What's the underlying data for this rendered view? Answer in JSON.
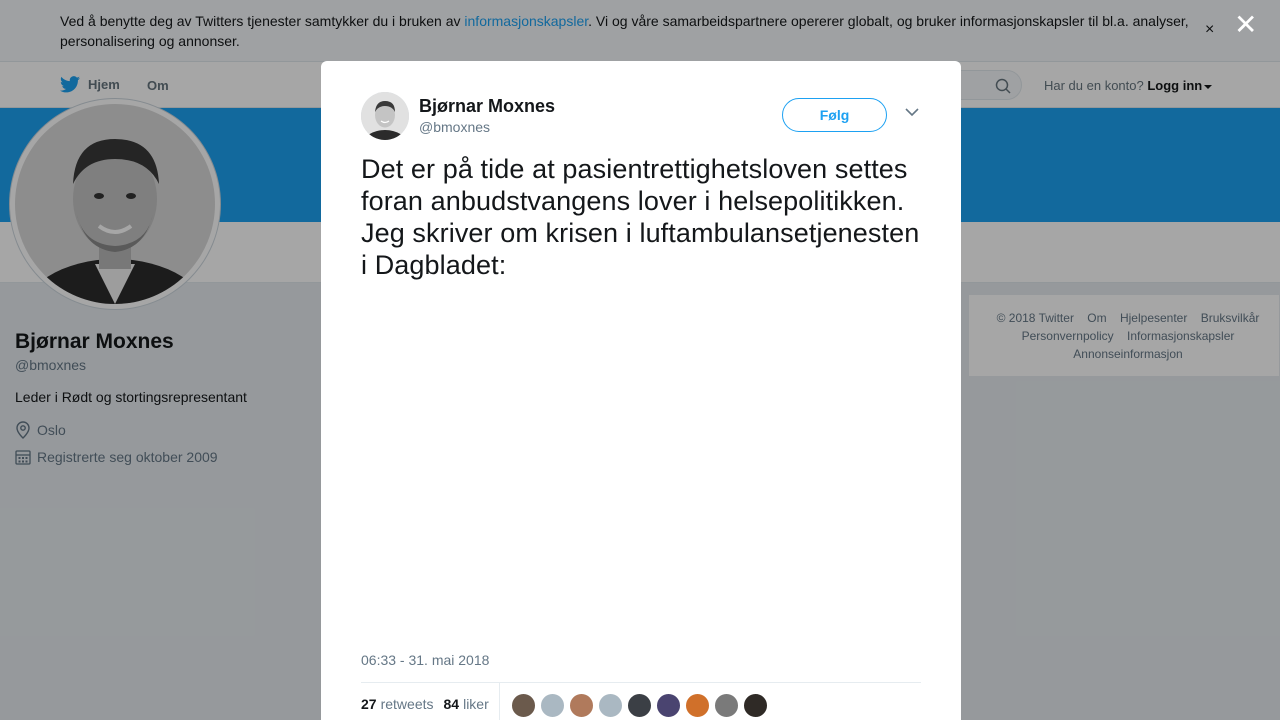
{
  "cookie": {
    "text_before": "Ved å benytte deg av Twitters tjenester samtykker du i bruken av ",
    "link_text": "informasjonskapsler",
    "text_after": ". Vi og våre samarbeidspartnere opererer globalt, og bruker informasjonskapsler til bl.a. analyser, personalisering og annonser.",
    "close_glyph": "×"
  },
  "nav": {
    "home_label": "Hjem",
    "about_label": "Om",
    "account_prompt": "Har du en konto?",
    "login_label": "Logg inn"
  },
  "profile": {
    "name": "Bjørnar Moxnes",
    "handle": "@bmoxnes",
    "bio": "Leder i Rødt og stortingsrepresentant",
    "location": "Oslo",
    "joined": "Registrerte seg oktober 2009"
  },
  "footer": {
    "links": [
      "© 2018 Twitter",
      "Om",
      "Hjelpesenter",
      "Bruksvilkår",
      "Personvernpolicy",
      "Informasjonskapsler",
      "Annonseinformasjon"
    ]
  },
  "overlay": {
    "close_glyph": "✕"
  },
  "tweet": {
    "author_name": "Bjørnar Moxnes",
    "author_handle": "@bmoxnes",
    "follow_label": "Følg",
    "text": "Det er på tide at pasientrettighetsloven settes foran anbudstvangens lover i helsepolitikken. Jeg skriver om krisen i luftambulansetjenesten i Dagbladet:",
    "timestamp": "06:33 - 31. mai 2018",
    "retweets_count": "27",
    "retweets_label": "retweets",
    "likes_count": "84",
    "likes_label": "liker"
  },
  "colors": {
    "accent": "#1da1f2",
    "liker_avatars": [
      "#6b5a4c",
      "#aab8c2",
      "#b07a5c",
      "#aab8c2",
      "#3b3f45",
      "#4a4470",
      "#d0702a",
      "#7a7a7a",
      "#2f2a26"
    ]
  }
}
